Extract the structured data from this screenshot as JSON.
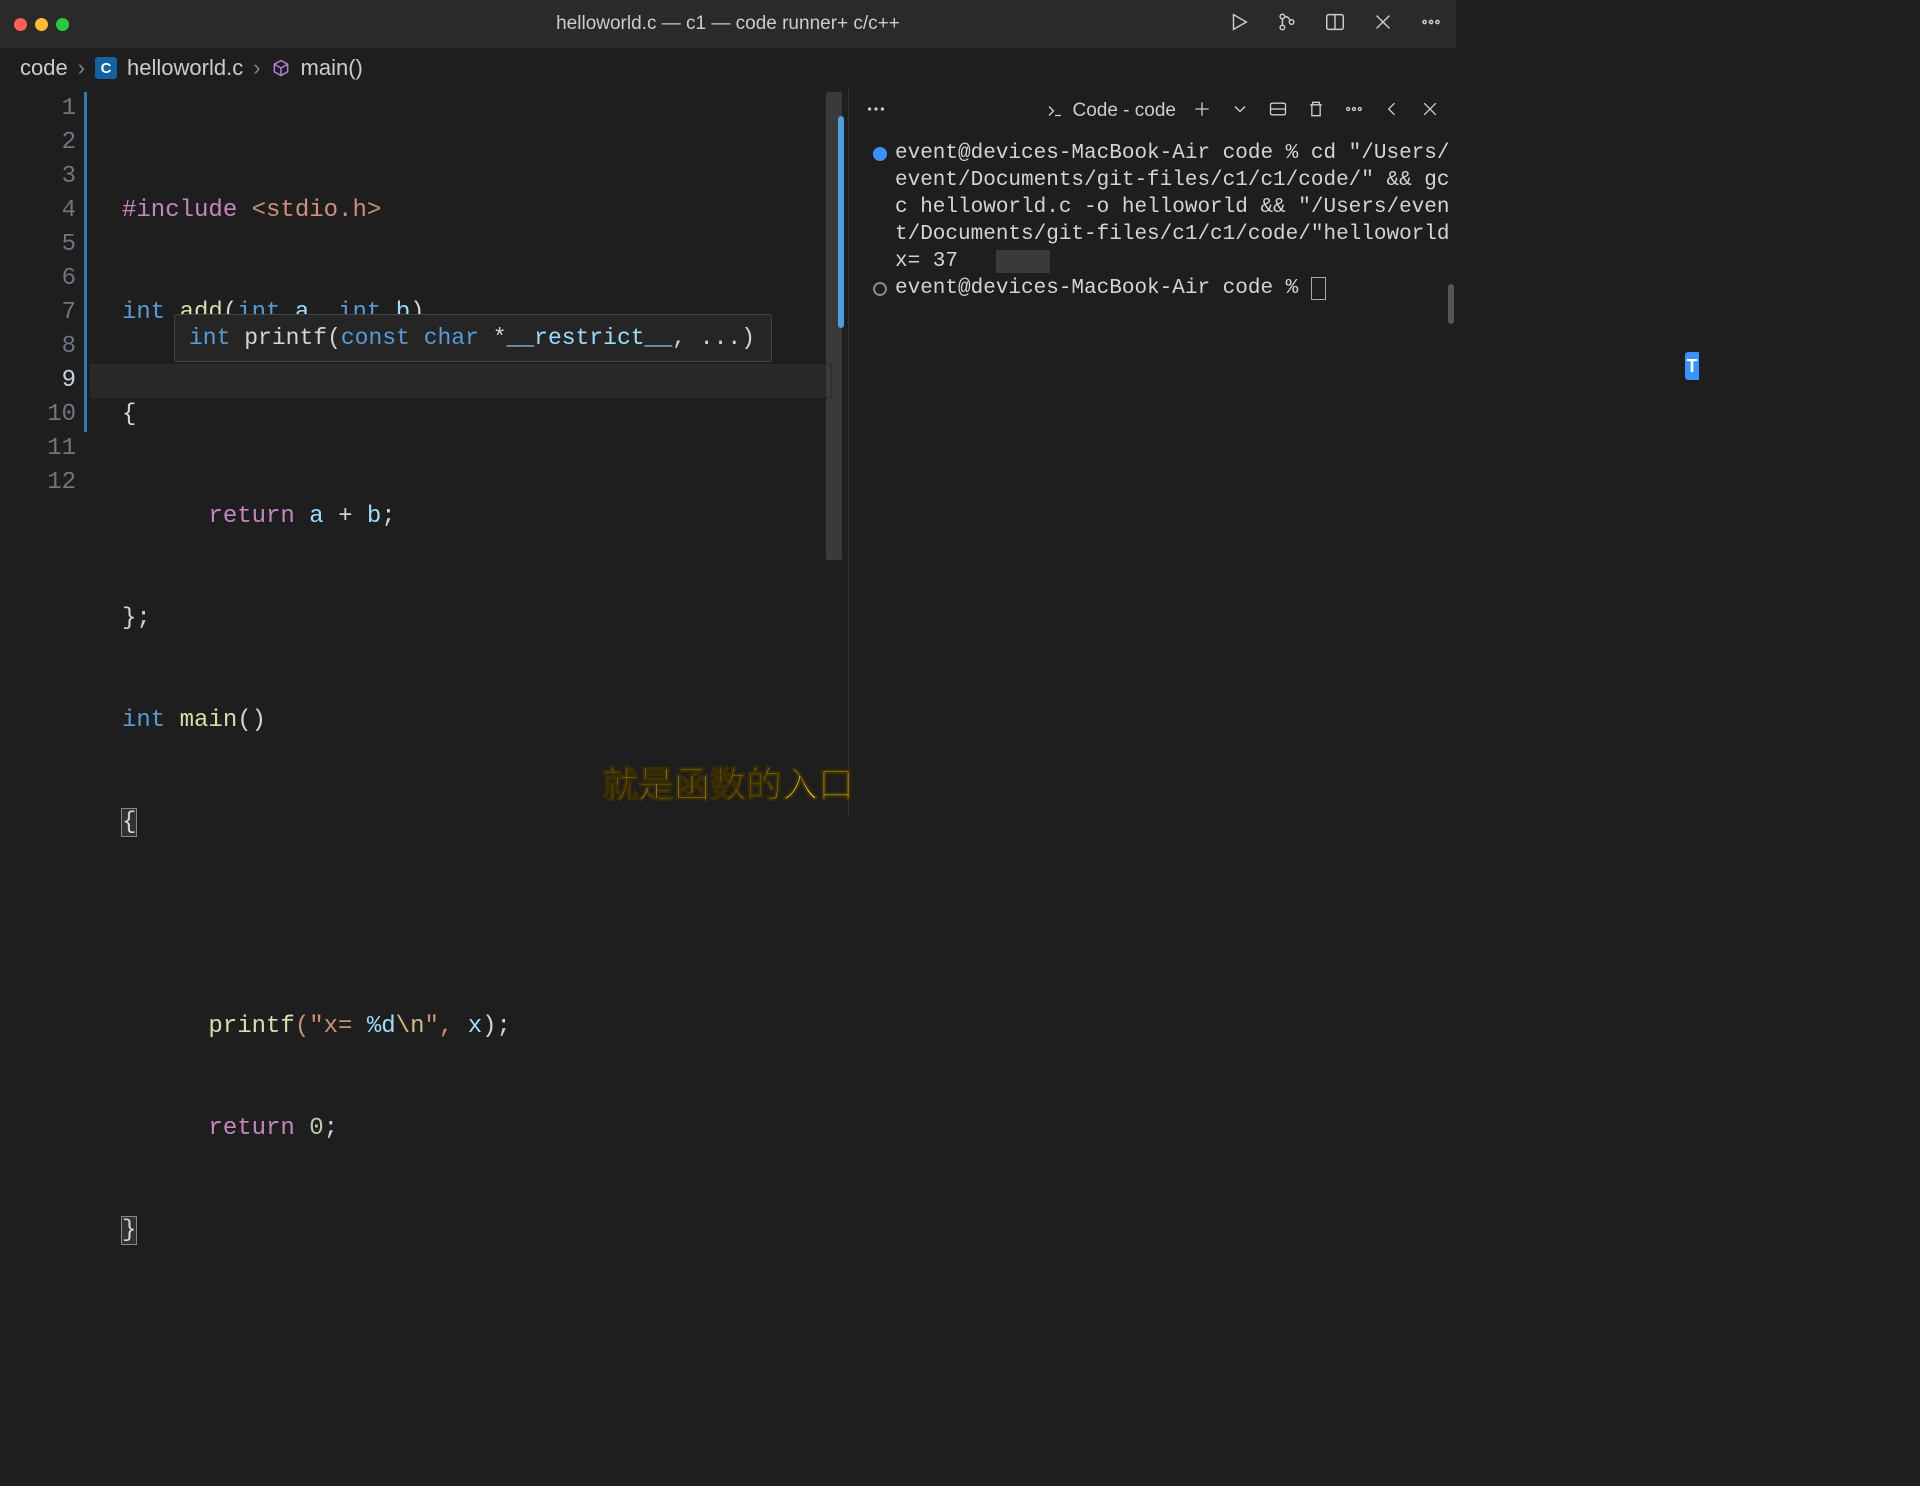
{
  "window": {
    "title": "helloworld.c — c1 — code runner+ c/c++"
  },
  "breadcrumb": {
    "root": "code",
    "file": "helloworld.c",
    "symbol": "main()"
  },
  "editor": {
    "line_count": 12,
    "active_line": 9,
    "lines": {
      "l1_include": "#include",
      "l1_header": "<stdio.h>",
      "l2_int": "int",
      "l2_add": "add",
      "l2_p1_int": "int",
      "l2_p1_name": "a",
      "l2_p2_int": "int",
      "l2_p2_name": "b",
      "l3_brace": "{",
      "l4_return": "return",
      "l4_a": "a",
      "l4_plus": "+",
      "l4_b": "b",
      "l4_semi": ";",
      "l5_brace": "}",
      "l5_semi": ";",
      "l6_int": "int",
      "l6_main": "main",
      "l6_par": "()",
      "l7_brace": "{",
      "l9_printf": "printf",
      "l9_str_open": "(\"x= ",
      "l9_fmt": "%d",
      "l9_esc": "\\n",
      "l9_str_close": "\", ",
      "l9_x": "x",
      "l9_end": ");",
      "l10_return": "return",
      "l10_zero": "0",
      "l10_semi": ";",
      "l11_brace": "}"
    },
    "param_hint": {
      "int": "int",
      "name": "printf",
      "open": "(",
      "const": "const",
      "char": "char",
      "star": "*",
      "restrict": "__restrict__",
      "rest": ", ...)"
    }
  },
  "terminal": {
    "tab_label": "Code - code",
    "lines": [
      "event@devices-MacBook-Air code % cd \"/Users/event/Documents/git-files/c1/c1/code/\" && gcc helloworld.c -o helloworld && \"/Users/event/Documents/git-files/c1/c1/code/\"helloworld",
      "x= 37",
      "event@devices-MacBook-Air code % "
    ]
  },
  "subtitle": "就是函数的入口",
  "annotate_tab": "T"
}
